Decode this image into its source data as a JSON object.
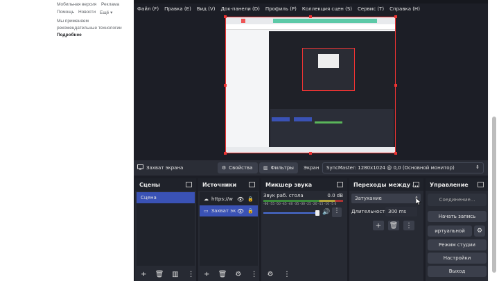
{
  "browser": {
    "links": {
      "mobile": "Мобильная версия",
      "ads": "Реклама",
      "help": "Помощь",
      "news": "Новости",
      "more": "Ещё ▾"
    },
    "notice": {
      "line1": "Мы применяем",
      "line2": "рекомендательные технологии",
      "more": "Подробнее"
    }
  },
  "obs": {
    "menu": [
      "Файл (F)",
      "Правка (E)",
      "Вид (V)",
      "Док-панели (D)",
      "Профиль (P)",
      "Коллекция сцен (S)",
      "Сервис (T)",
      "Справка (H)"
    ],
    "source_bar": {
      "source_name": "Захват экрана",
      "properties": "Свойства",
      "filters": "Фильтры",
      "screen_label": "Экран",
      "screen_value": "SyncMaster: 1280x1024 @ 0,0 (Основной монитор)"
    },
    "scenes": {
      "title": "Сцены",
      "items": [
        "Сцена"
      ]
    },
    "sources": {
      "title": "Источники",
      "items": [
        "https://w",
        "Захват эк"
      ]
    },
    "mixer": {
      "title": "Микшер звука",
      "channel": "Звук раб. стола",
      "level": "0.0 dB",
      "scale": "-60 -55 -50 -45 -40 -35 -30 -25 -20 -15 -10 -5 0"
    },
    "transitions": {
      "title": "Переходы между ...",
      "selected": "Затухание",
      "duration_label": "Длительность",
      "duration_value": "300 ms"
    },
    "controls": {
      "title": "Управление",
      "connecting": "Соединение...",
      "start_recording": "Начать запись",
      "virtual_cam": "иртуальной",
      "studio_mode": "Режим студии",
      "settings": "Настройки",
      "exit": "Выход"
    }
  }
}
